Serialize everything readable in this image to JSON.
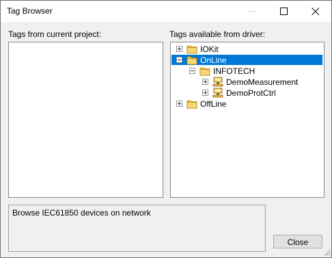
{
  "window": {
    "title": "Tag Browser"
  },
  "left_panel": {
    "label": "Tags from current project:"
  },
  "right_panel": {
    "label": "Tags available from driver:",
    "tree": [
      {
        "label": "IOKit",
        "expander": "plus",
        "icon": "folder-icon",
        "selected": false
      },
      {
        "label": "OnLine",
        "expander": "minus",
        "icon": "folder-icon",
        "selected": true
      },
      {
        "label": "INFOTECH",
        "expander": "minus",
        "icon": "folder-icon",
        "selected": false
      },
      {
        "label": "DemoMeasurement",
        "expander": "plus",
        "icon": "device-icon",
        "selected": false
      },
      {
        "label": "DemoProtCtrl",
        "expander": "plus",
        "icon": "device-icon",
        "selected": false
      },
      {
        "label": "OffLine",
        "expander": "plus",
        "icon": "folder-icon",
        "selected": false
      }
    ]
  },
  "status": {
    "text": "Browse IEC61850 devices on network"
  },
  "buttons": {
    "close_label": "Close"
  },
  "colors": {
    "selection": "#0078d7",
    "folder": "#e8b84a"
  }
}
